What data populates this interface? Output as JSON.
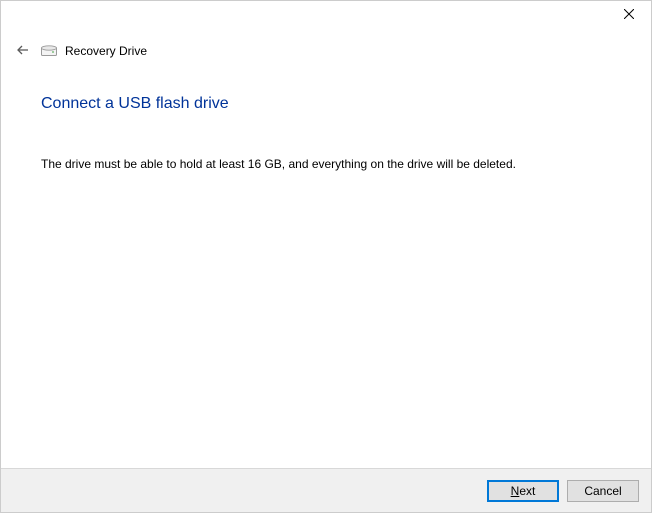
{
  "window": {
    "app_name": "Recovery Drive"
  },
  "page": {
    "heading": "Connect a USB flash drive",
    "body": "The drive must be able to hold at least 16 GB, and everything on the drive will be deleted."
  },
  "footer": {
    "next_mnemonic": "N",
    "next_rest": "ext",
    "cancel_label": "Cancel"
  }
}
